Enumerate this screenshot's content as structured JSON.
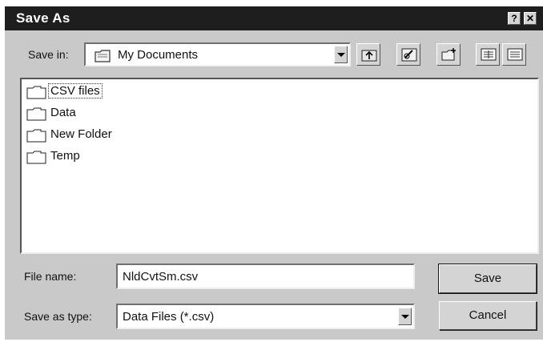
{
  "window": {
    "title": "Save As",
    "help_glyph": "?",
    "close_glyph": "✕"
  },
  "toolbar": {
    "save_in_label": "Save in:",
    "save_in_value": "My Documents",
    "buttons": [
      "up-one-level-icon",
      "desktop-icon",
      "new-folder-icon",
      "list-view-icon",
      "details-view-icon"
    ]
  },
  "files": [
    {
      "name": "CSV files",
      "selected": true
    },
    {
      "name": "Data"
    },
    {
      "name": "New Folder"
    },
    {
      "name": "Temp"
    }
  ],
  "form": {
    "file_name_label": "File name:",
    "file_name_value": "NldCvtSm.csv",
    "save_as_type_label": "Save as type:",
    "save_as_type_value": "Data Files (*.csv)"
  },
  "actions": {
    "save_label": "Save",
    "cancel_label": "Cancel"
  }
}
